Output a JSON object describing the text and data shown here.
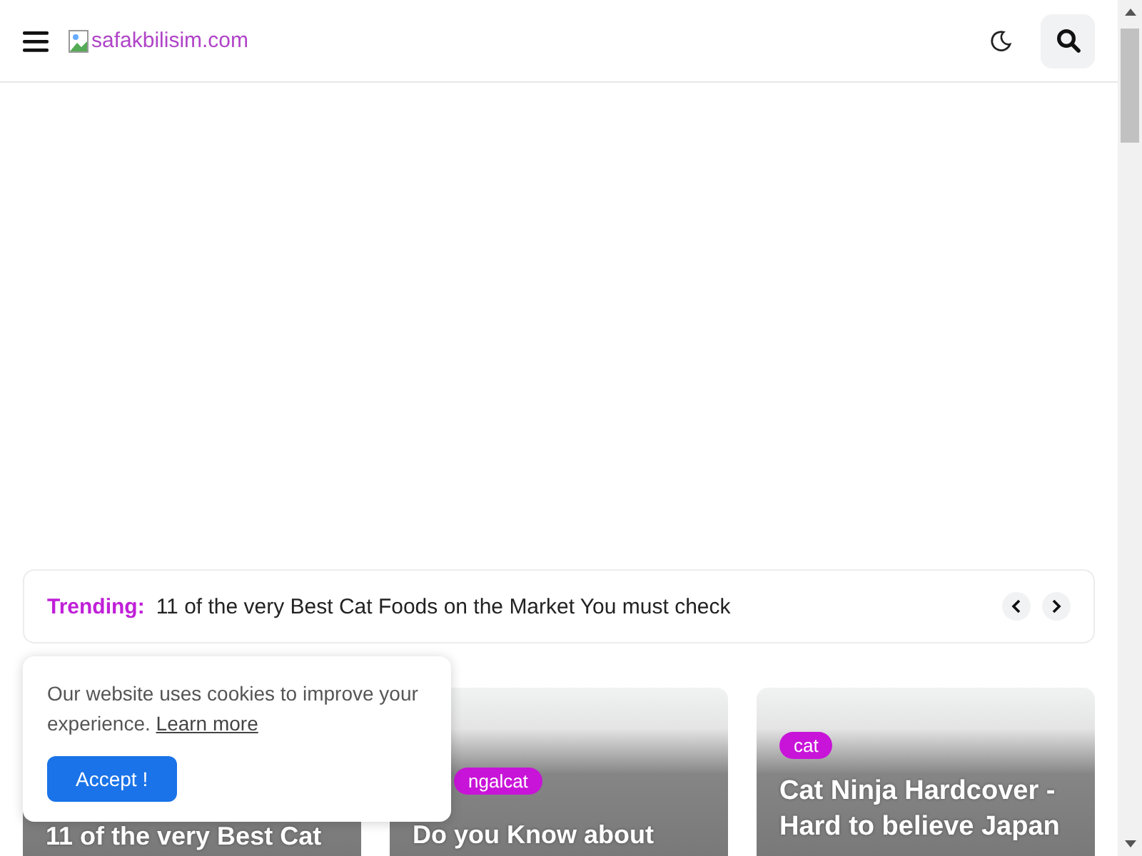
{
  "header": {
    "logo_alt": "safakbilisim.com"
  },
  "trending": {
    "label": "Trending:",
    "headline": "11 of the very Best Cat Foods on the Market You must check"
  },
  "cards": [
    {
      "title": "11 of the very Best Cat"
    },
    {
      "tag": "ngalcat",
      "title": "Do you Know about"
    },
    {
      "tag": "cat",
      "title": "Cat Ninja Hardcover - Hard to believe Japan"
    }
  ],
  "cookie": {
    "text": "Our website uses cookies to improve your experience.",
    "link": "Learn more",
    "button": "Accept !"
  }
}
